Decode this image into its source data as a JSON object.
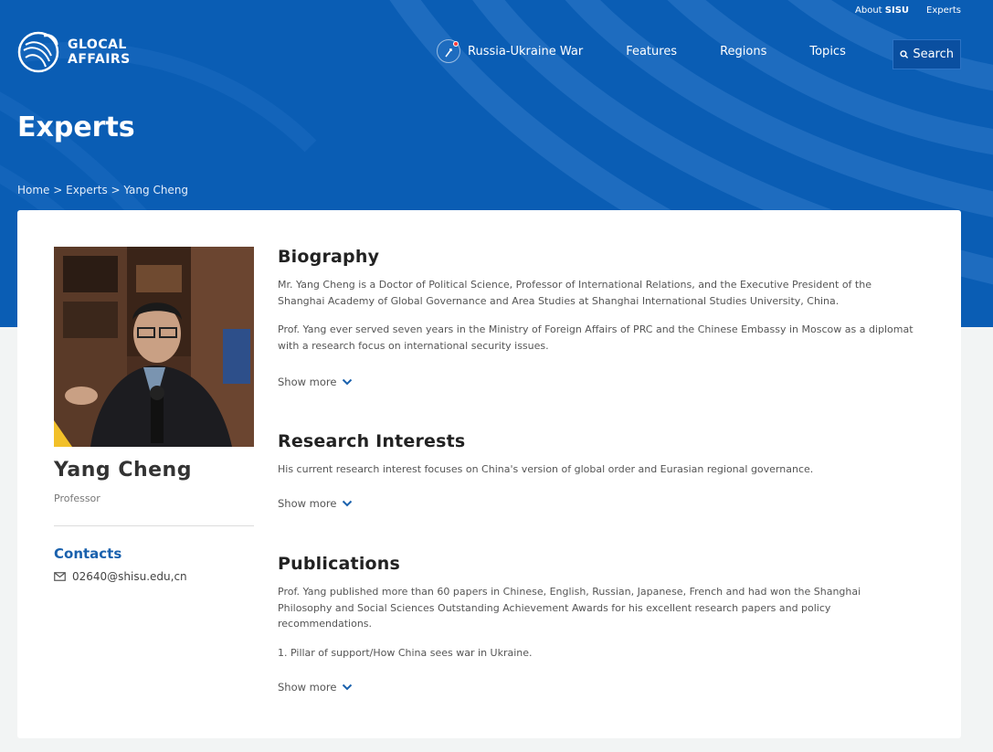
{
  "header": {
    "top_links": [
      {
        "pre": "About ",
        "bold": "SISU"
      },
      {
        "pre": "Experts",
        "bold": ""
      }
    ],
    "logo_line1": "GLOCAL",
    "logo_line2": "AFFAIRS",
    "nav": {
      "war": "Russia-Ukraine War",
      "features": "Features",
      "regions": "Regions",
      "topics": "Topics",
      "search": "Search"
    }
  },
  "page": {
    "title": "Experts",
    "breadcrumb": "Home > Experts > Yang Cheng"
  },
  "profile": {
    "name": "Yang Cheng",
    "role": "Professor",
    "contacts_title": "Contacts",
    "email": "02640@shisu.edu,cn"
  },
  "biography": {
    "title": "Biography",
    "p1": "Mr. Yang Cheng is a Doctor of Political Science, Professor of International Relations, and the Executive President of the Shanghai Academy of Global Governance and Area Studies at Shanghai International Studies University, China.",
    "p2": "Prof. Yang ever served seven years in the Ministry of Foreign Affairs of PRC and the Chinese Embassy in Moscow as a diplomat with a research focus on international security issues.",
    "show_more": "Show more"
  },
  "research": {
    "title": "Research Interests",
    "p1": "His current research interest focuses on China's version of global order and Eurasian regional governance.",
    "show_more": "Show more"
  },
  "publications": {
    "title": "Publications",
    "p1": "Prof. Yang published more than 60 papers in Chinese, English, Russian, Japanese, French and had won the Shanghai Philosophy and Social Sciences Outstanding Achievement Awards for his excellent research papers and policy recommendations.",
    "p2": "1. Pillar of support/How China sees war in Ukraine.",
    "show_more": "Show more"
  },
  "colors": {
    "hero_blue": "#0a5db4",
    "accent_blue": "#1a61ad",
    "alert_red": "#ff3b3b"
  },
  "icons": [
    "logo-icon",
    "war-globe-icon",
    "search-icon",
    "mail-icon",
    "chevron-down-icon"
  ]
}
